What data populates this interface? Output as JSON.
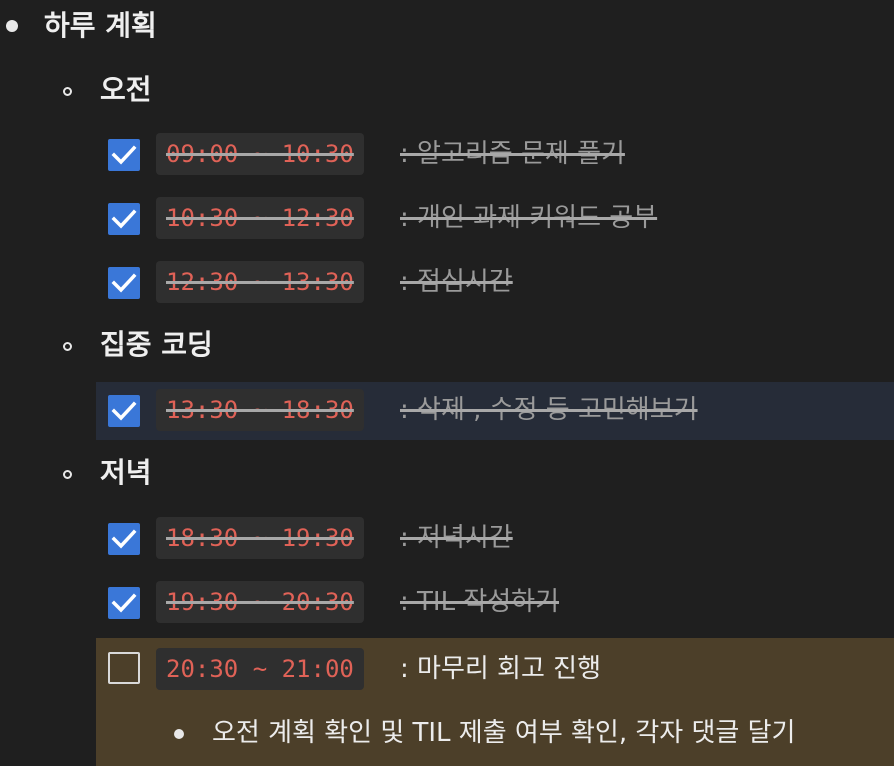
{
  "title": "하루 계획",
  "sections": [
    {
      "heading": "오전",
      "tasks": [
        {
          "time": "09:00 ~ 10:30",
          "text": ": 알고리즘 문제 풀기 ",
          "done": true
        },
        {
          "time": "10:30 ~ 12:30",
          "text": ": 개인 과제 키워드 공부",
          "done": true
        },
        {
          "time": "12:30 ~ 13:30",
          "text": ": 점심시간 ",
          "done": true
        }
      ]
    },
    {
      "heading": "집중 코딩",
      "tasks": [
        {
          "time": "13:30 ~ 18:30",
          "text": ": 삭제 , 수정 등 고민해보기",
          "done": true
        }
      ]
    },
    {
      "heading": "저녁",
      "tasks": [
        {
          "time": "18:30 ~ 19:30",
          "text": ": 저녁시간",
          "done": true
        },
        {
          "time": "19:30 ~ 20:30",
          "text": ": TIL 작성하기",
          "done": true
        },
        {
          "time": "20:30 ~ 21:00",
          "text": ": 마무리 회고 진행",
          "done": false
        }
      ]
    }
  ],
  "sub_note": "오전 계획 확인 및 TIL 제출 여부 확인, 각자 댓글 달기",
  "colors": {
    "background": "#1f1f1f",
    "checkbox_checked": "#3a77d8",
    "time_text": "#e06257",
    "highlight_blue": "#262c38",
    "highlight_brown": "#4c3f29"
  }
}
